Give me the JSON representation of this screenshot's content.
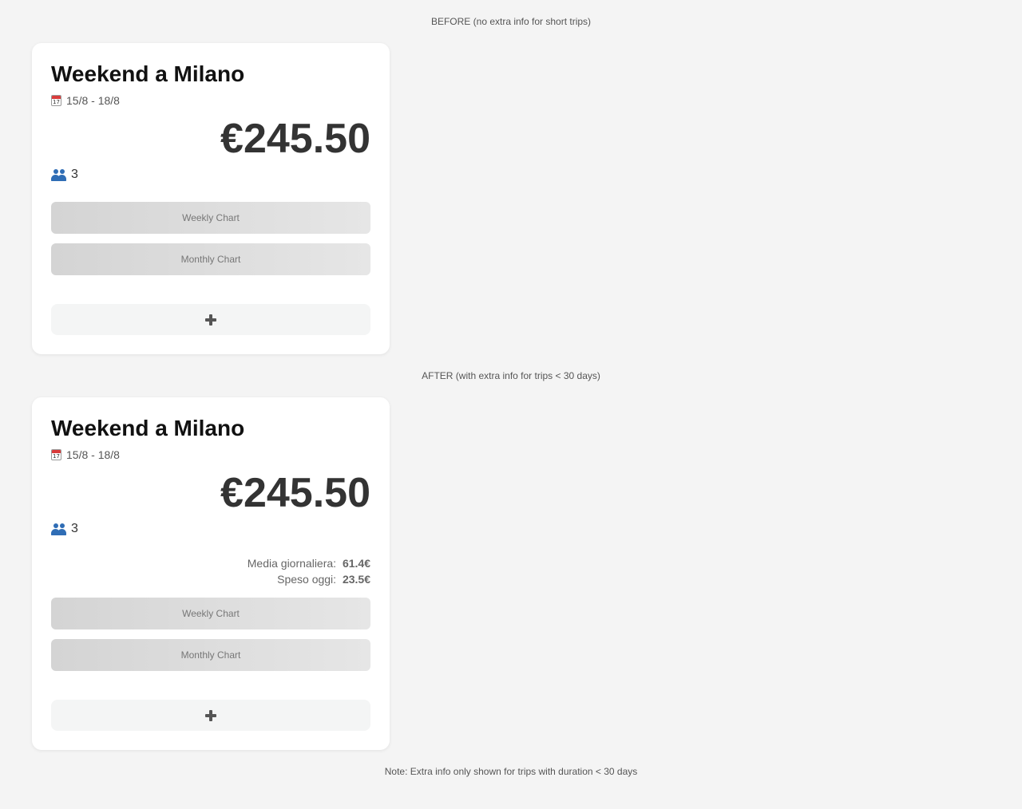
{
  "captions": {
    "before": "BEFORE (no extra info for short trips)",
    "after": "AFTER (with extra info for trips < 30 days)",
    "note": "Note: Extra info only shown for trips with duration < 30 days"
  },
  "cards": {
    "before": {
      "title": "Weekend a Milano",
      "dates": "15/8 - 18/8",
      "amount": "€245.50",
      "people": "3",
      "weekly_chart_label": "Weekly Chart",
      "monthly_chart_label": "Monthly Chart",
      "add_icon": "plus-icon"
    },
    "after": {
      "title": "Weekend a Milano",
      "dates": "15/8 - 18/8",
      "amount": "€245.50",
      "people": "3",
      "extra": {
        "daily_avg_label": "Media giornaliera:",
        "daily_avg_value": "61.4€",
        "spent_today_label": "Speso oggi:",
        "spent_today_value": "23.5€"
      },
      "weekly_chart_label": "Weekly Chart",
      "monthly_chart_label": "Monthly Chart",
      "add_icon": "plus-icon"
    }
  },
  "icons": {
    "dates": "calendar-icon",
    "people": "people-icon"
  },
  "colors": {
    "background": "#f4f4f4",
    "card": "#ffffff",
    "people_icon": "#2f6db5",
    "calendar_header": "#d93b3b"
  }
}
